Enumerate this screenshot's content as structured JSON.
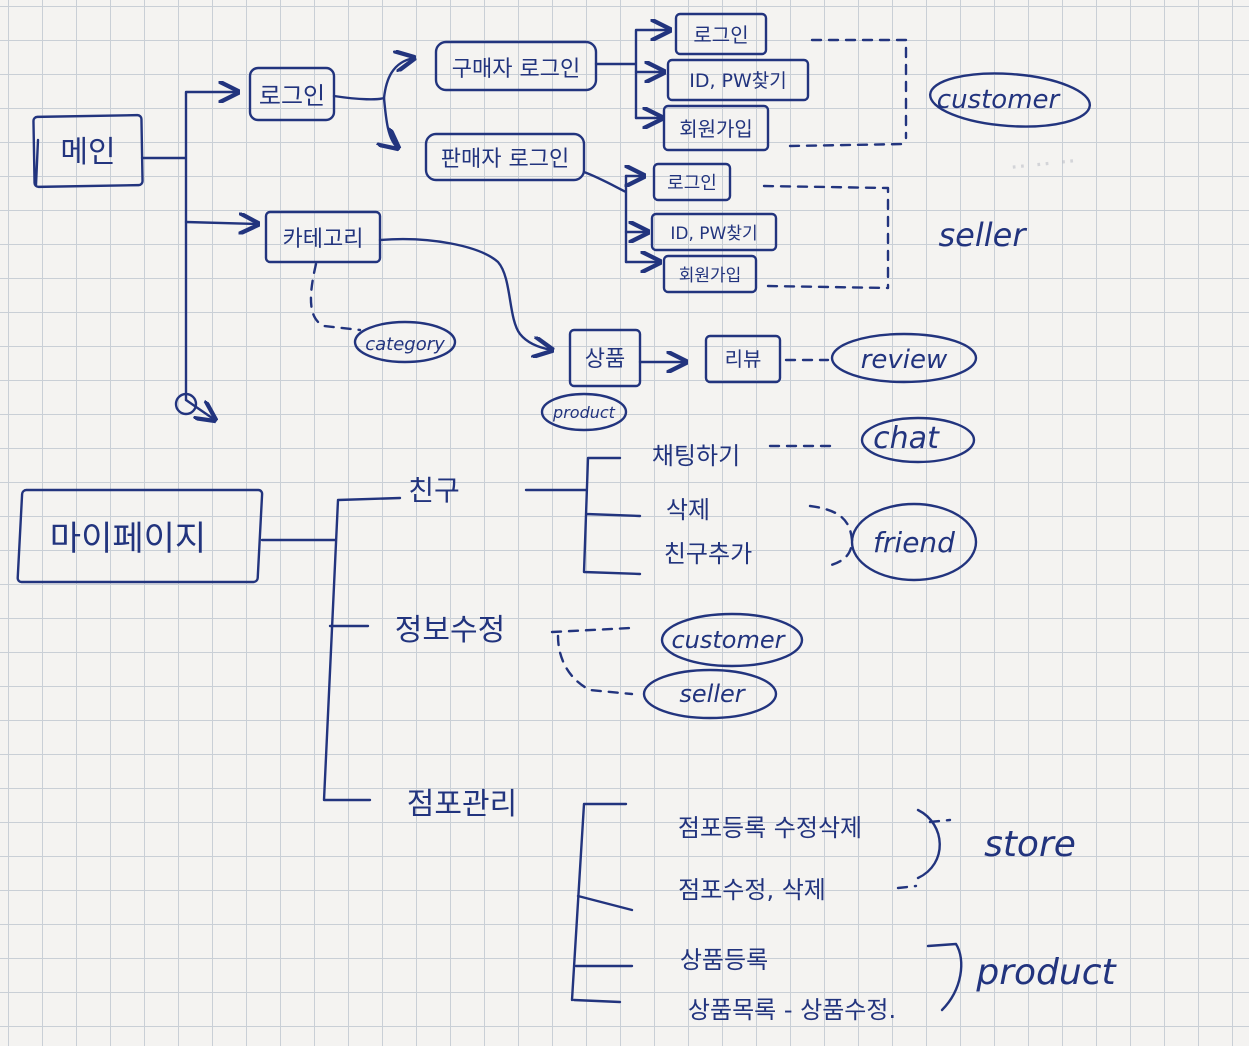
{
  "main": "메인",
  "login": "로그인",
  "buyer_login": {
    "title": "구매자 로그인",
    "items": [
      "로그인",
      "ID, PW찾기",
      "회원가입"
    ],
    "tag": "customer"
  },
  "seller_login": {
    "title": "판매자 로그인",
    "items": [
      "로그인",
      "ID, PW찾기",
      "회원가입"
    ],
    "tag": "seller"
  },
  "category": {
    "label": "카테고리",
    "tag": "category"
  },
  "product": {
    "label": "상품",
    "tag": "product"
  },
  "review": {
    "label": "리뷰",
    "tag": "review"
  },
  "mypage": "마이페이지",
  "friend": {
    "label": "친구",
    "items": [
      "채팅하기",
      "삭제",
      "친구추가"
    ],
    "chat_tag": "chat",
    "friend_tag": "friend"
  },
  "info_edit": {
    "label": "정보수정",
    "tags": [
      "customer",
      "seller"
    ]
  },
  "store_manage": {
    "label": "점포관리",
    "items": [
      "점포등록 수정삭제",
      "점포수정, 삭제",
      "상품등록",
      "상품목록 - 상품수정."
    ],
    "store_tag": "store",
    "product_tag": "product"
  }
}
